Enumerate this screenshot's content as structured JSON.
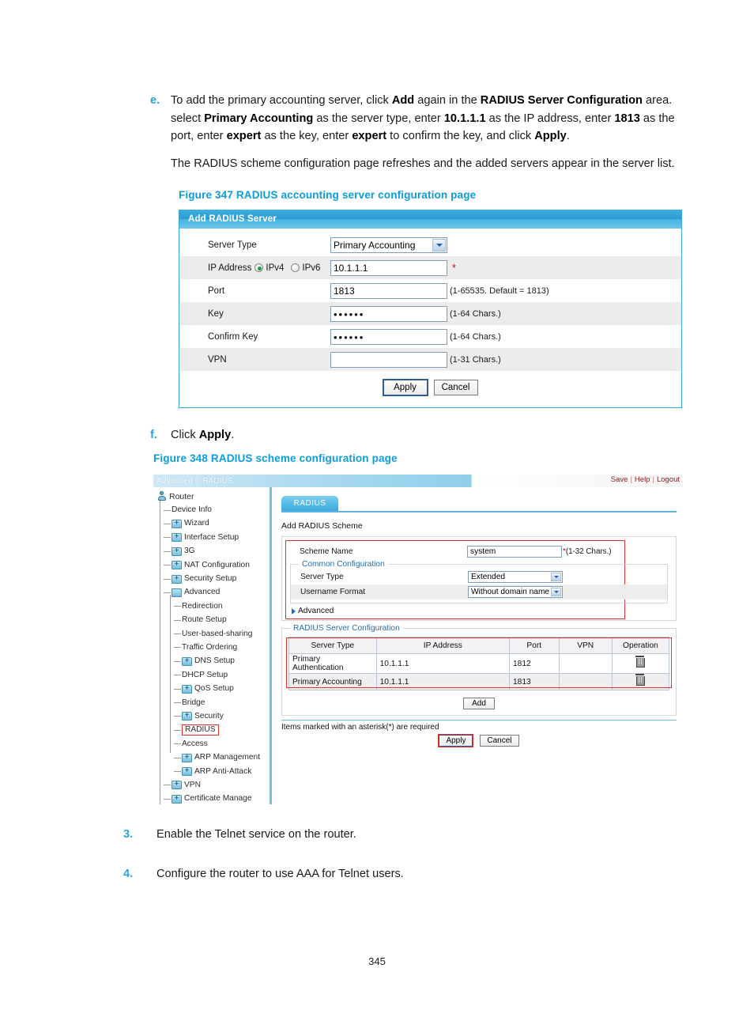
{
  "page": {
    "number": "345"
  },
  "step_e": {
    "marker": "e.",
    "para1_parts": [
      {
        "t": "To add the primary accounting server, click ",
        "b": false
      },
      {
        "t": "Add",
        "b": true
      },
      {
        "t": " again in the ",
        "b": false
      },
      {
        "t": "RADIUS Server Configuration",
        "b": true
      },
      {
        "t": " area. select ",
        "b": false
      },
      {
        "t": "Primary Accounting",
        "b": true
      },
      {
        "t": " as the server type, enter ",
        "b": false
      },
      {
        "t": "10.1.1.1",
        "b": true
      },
      {
        "t": " as the IP address, enter ",
        "b": false
      },
      {
        "t": "1813",
        "b": true
      },
      {
        "t": " as the port, enter ",
        "b": false
      },
      {
        "t": "expert",
        "b": true
      },
      {
        "t": " as the key, enter ",
        "b": false
      },
      {
        "t": "expert",
        "b": true
      },
      {
        "t": " to confirm the key, and click ",
        "b": false
      },
      {
        "t": "Apply",
        "b": true
      },
      {
        "t": ".",
        "b": false
      }
    ],
    "para2": "The RADIUS scheme configuration page refreshes and the added servers appear in the server list."
  },
  "step_f": {
    "marker": "f.",
    "parts": [
      {
        "t": "Click ",
        "b": false
      },
      {
        "t": "Apply",
        "b": true
      },
      {
        "t": ".",
        "b": false
      }
    ]
  },
  "figure_347": {
    "caption": "Figure 347 RADIUS accounting server configuration page",
    "dialog_title": "Add RADIUS Server",
    "rows": [
      {
        "label": "Server Type",
        "control": "select",
        "value": "Primary Accounting",
        "hint": ""
      },
      {
        "label": "IP Address",
        "control": "ip",
        "value": "10.1.1.1",
        "hint": "",
        "required": true,
        "radios": [
          {
            "label": "IPv4",
            "selected": true
          },
          {
            "label": "IPv6",
            "selected": false
          }
        ]
      },
      {
        "label": "Port",
        "control": "text",
        "value": "1813",
        "hint": "(1-65535. Default = 1813)"
      },
      {
        "label": "Key",
        "control": "password",
        "value": "••••••",
        "hint": "(1-64 Chars.)"
      },
      {
        "label": "Confirm Key",
        "control": "password",
        "value": "••••••",
        "hint": "(1-64 Chars.)"
      },
      {
        "label": "VPN",
        "control": "text",
        "value": "",
        "hint": "(1-31 Chars.)"
      }
    ],
    "buttons": {
      "apply": "Apply",
      "cancel": "Cancel"
    }
  },
  "figure_348": {
    "caption": "Figure 348 RADIUS scheme configuration page",
    "breadcrumb": "Advanced > RADIUS",
    "top_links": [
      "Save",
      "Help",
      "Logout"
    ],
    "sidebar": {
      "root": "Router",
      "items": [
        {
          "label": "Device Info",
          "level": 1,
          "icon": "none"
        },
        {
          "label": "Wizard",
          "level": 1,
          "icon": "folder-plus"
        },
        {
          "label": "Interface Setup",
          "level": 1,
          "icon": "folder-plus"
        },
        {
          "label": "3G",
          "level": 1,
          "icon": "folder-plus"
        },
        {
          "label": "NAT Configuration",
          "level": 1,
          "icon": "folder-plus"
        },
        {
          "label": "Security Setup",
          "level": 1,
          "icon": "folder-plus"
        },
        {
          "label": "Advanced",
          "level": 1,
          "icon": "folder-open"
        },
        {
          "label": "Redirection",
          "level": 2,
          "icon": "none"
        },
        {
          "label": "Route Setup",
          "level": 2,
          "icon": "none"
        },
        {
          "label": "User-based-sharing",
          "level": 2,
          "icon": "none"
        },
        {
          "label": "Traffic Ordering",
          "level": 2,
          "icon": "none"
        },
        {
          "label": "DNS Setup",
          "level": 2,
          "icon": "folder-plus"
        },
        {
          "label": "DHCP Setup",
          "level": 2,
          "icon": "none"
        },
        {
          "label": "QoS Setup",
          "level": 2,
          "icon": "folder-plus"
        },
        {
          "label": "Bridge",
          "level": 2,
          "icon": "none"
        },
        {
          "label": "Security",
          "level": 2,
          "icon": "folder-plus"
        },
        {
          "label": "RADIUS",
          "level": 2,
          "icon": "none",
          "selected": true
        },
        {
          "label": "Access",
          "level": 2,
          "icon": "none"
        },
        {
          "label": "ARP Management",
          "level": 2,
          "icon": "folder-plus"
        },
        {
          "label": "ARP Anti-Attack",
          "level": 2,
          "icon": "folder-plus"
        },
        {
          "label": "VPN",
          "level": 1,
          "icon": "folder-plus"
        },
        {
          "label": "Certificate Manage",
          "level": 1,
          "icon": "folder-plus"
        }
      ]
    },
    "tab": "RADIUS",
    "section_title": "Add RADIUS Scheme",
    "scheme": {
      "name_label": "Scheme Name",
      "name_value": "system",
      "name_star": "*",
      "name_hint": "(1-32 Chars.)",
      "common_legend": "Common Configuration",
      "server_type_label": "Server Type",
      "server_type_value": "Extended",
      "username_format_label": "Username Format",
      "username_format_value": "Without domain name",
      "advanced_toggle": "Advanced"
    },
    "server_config": {
      "legend": "RADIUS Server Configuration",
      "headers": [
        "Server Type",
        "IP Address",
        "Port",
        "VPN",
        "Operation"
      ],
      "rows": [
        {
          "type": "Primary Authentication",
          "ip": "10.1.1.1",
          "port": "1812",
          "vpn": "",
          "op": "delete-icon"
        },
        {
          "type": "Primary Accounting",
          "ip": "10.1.1.1",
          "port": "1813",
          "vpn": "",
          "op": "delete-icon"
        }
      ],
      "add_button": "Add"
    },
    "footnote": "Items marked with an asterisk(*) are required",
    "buttons": {
      "apply": "Apply",
      "cancel": "Cancel"
    }
  },
  "step_3": {
    "marker": "3.",
    "text": "Enable the Telnet service on the router."
  },
  "step_4": {
    "marker": "4.",
    "text": "Configure the router to use AAA for Telnet users."
  },
  "colors": {
    "accent_blue": "#0e9ddb",
    "marker_blue": "#27a4dd",
    "highlight_red": "#e03030",
    "required_red": "#d0021b"
  }
}
